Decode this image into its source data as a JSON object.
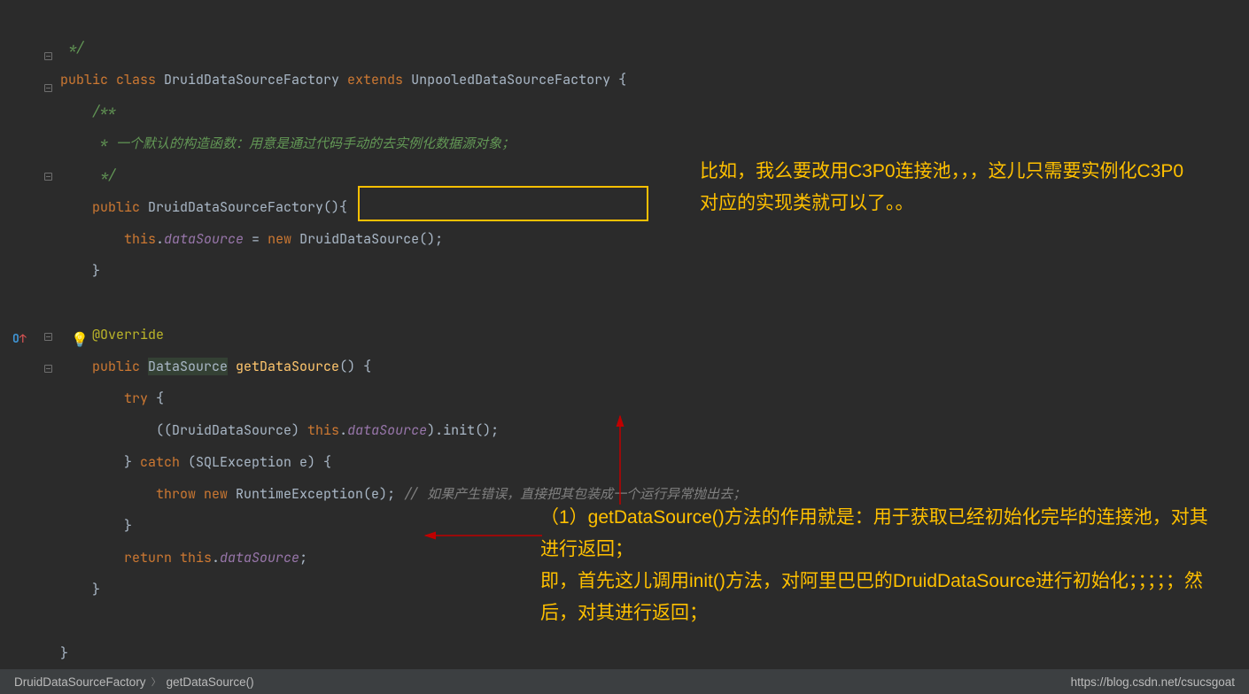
{
  "code": {
    "l1": " */",
    "l2_public": "public",
    "l2_class": " class ",
    "l2_name": "DruidDataSourceFactory",
    "l2_extends": " extends ",
    "l2_parent": "UnpooledDataSourceFactory",
    "l2_brace": " {",
    "l3": "    /**",
    "l4": "     * 一个默认的构造函数：用意是通过代码手动的去实例化数据源对象；",
    "l5": "     */",
    "l6_public": "    public ",
    "l6_name": "DruidDataSourceFactory",
    "l6_rest": "(){",
    "l7_this": "        this",
    "l7_dot1": ".",
    "l7_field": "dataSource",
    "l7_eq": " = ",
    "l7_new": "new ",
    "l7_cls": "DruidDataSource",
    "l7_end": "();",
    "l8": "    }",
    "l9": "",
    "l10": "    @Override",
    "l11_public": "    public ",
    "l11_type": "DataSource",
    "l11_sp": " ",
    "l11_method": "getDataSource",
    "l11_rest": "() {",
    "l12_try": "        try ",
    "l12_brace": "{",
    "l13_open": "            ((",
    "l13_cast": "DruidDataSource",
    "l13_close": ") ",
    "l13_this": "this",
    "l13_dot": ".",
    "l13_field": "dataSource",
    "l13_call": ").init();",
    "l14_close": "        } ",
    "l14_catch": "catch ",
    "l14_rest": "(SQLException e) {",
    "l15_throw": "            throw ",
    "l15_new": "new ",
    "l15_cls": "RuntimeException",
    "l15_arg": "(e)",
    "l15_sc": "; ",
    "l15_comment": "// 如果产生错误，直接把其包装成一个运行异常抛出去；",
    "l16": "        }",
    "l17_return": "        return ",
    "l17_this": "this",
    "l17_dot": ".",
    "l17_field": "dataSource",
    "l17_sc": ";",
    "l18": "    }",
    "l19": "",
    "l20": "}"
  },
  "annotations": {
    "top": "比如，我么要改用C3P0连接池，，，这儿只需要实例化C3P0对应的实现类就可以了。。",
    "bottom": "（1）getDataSource()方法的作用就是：用于获取已经初始化完毕的连接池，对其进行返回；\n即，首先这儿调用init()方法，对阿里巴巴的DruidDataSource进行初始化；；；；；然后，对其进行返回；"
  },
  "breadcrumb": {
    "item1": "DruidDataSourceFactory",
    "item2": "getDataSource()",
    "watermark": "https://blog.csdn.net/csucsgoat"
  },
  "icons": {
    "bulb": "💡",
    "override_o": "O",
    "override_arrow": "↑"
  }
}
